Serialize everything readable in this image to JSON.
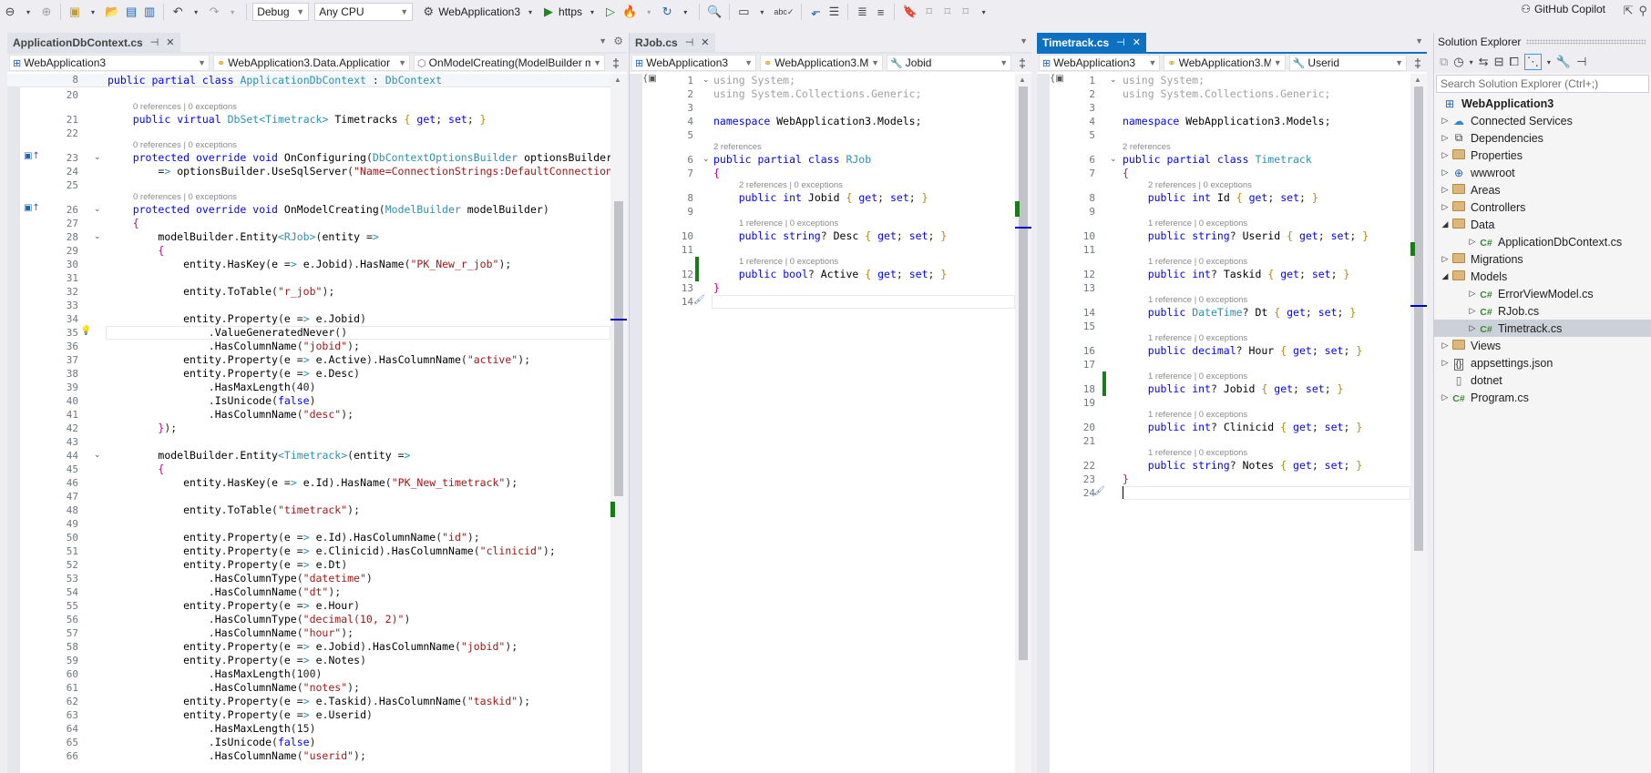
{
  "toolbar": {
    "config": "Debug",
    "platform": "Any CPU",
    "startup_project": "WebApplication3",
    "run_profile": "https",
    "copilot_label": "GitHub Copilot"
  },
  "left_editor": {
    "tab_title": "ApplicationDbContext.cs",
    "project_combo": "WebApplication3",
    "type_combo": "WebApplication3.Data.Applicatior",
    "member_combo": "OnModelCreating(ModelBuilder m",
    "sticky_line": {
      "num": "8",
      "text": "public partial class ApplicationDbContext : DbContext"
    },
    "lines": [
      {
        "num": "20",
        "text": ""
      },
      {
        "lens": "0 references | 0 exceptions"
      },
      {
        "num": "21",
        "text": "    public virtual DbSet<Timetrack> Timetracks { get; set; }"
      },
      {
        "num": "22",
        "text": ""
      },
      {
        "lens": "0 references | 0 exceptions"
      },
      {
        "num": "23",
        "text": "    protected override void OnConfiguring(DbContextOptionsBuilder optionsBuilder)"
      },
      {
        "num": "24",
        "text": "        => optionsBuilder.UseSqlServer(\"Name=ConnectionStrings:DefaultConnection\");"
      },
      {
        "num": "25",
        "text": ""
      },
      {
        "lens": "0 references | 0 exceptions"
      },
      {
        "num": "26",
        "text": "    protected override void OnModelCreating(ModelBuilder modelBuilder)"
      },
      {
        "num": "27",
        "text": "    {"
      },
      {
        "num": "28",
        "text": "        modelBuilder.Entity<RJob>(entity =>"
      },
      {
        "num": "29",
        "text": "        {"
      },
      {
        "num": "30",
        "text": "            entity.HasKey(e => e.Jobid).HasName(\"PK_New_r_job\");"
      },
      {
        "num": "31",
        "text": ""
      },
      {
        "num": "32",
        "text": "            entity.ToTable(\"r_job\");"
      },
      {
        "num": "33",
        "text": ""
      },
      {
        "num": "34",
        "text": "            entity.Property(e => e.Jobid)"
      },
      {
        "num": "35",
        "text": "                .ValueGeneratedNever()"
      },
      {
        "num": "36",
        "text": "                .HasColumnName(\"jobid\");"
      },
      {
        "num": "37",
        "text": "            entity.Property(e => e.Active).HasColumnName(\"active\");"
      },
      {
        "num": "38",
        "text": "            entity.Property(e => e.Desc)"
      },
      {
        "num": "39",
        "text": "                .HasMaxLength(40)"
      },
      {
        "num": "40",
        "text": "                .IsUnicode(false)"
      },
      {
        "num": "41",
        "text": "                .HasColumnName(\"desc\");"
      },
      {
        "num": "42",
        "text": "        });"
      },
      {
        "num": "43",
        "text": ""
      },
      {
        "num": "44",
        "text": "        modelBuilder.Entity<Timetrack>(entity =>"
      },
      {
        "num": "45",
        "text": "        {"
      },
      {
        "num": "46",
        "text": "            entity.HasKey(e => e.Id).HasName(\"PK_New_timetrack\");"
      },
      {
        "num": "47",
        "text": ""
      },
      {
        "num": "48",
        "text": "            entity.ToTable(\"timetrack\");"
      },
      {
        "num": "49",
        "text": ""
      },
      {
        "num": "50",
        "text": "            entity.Property(e => e.Id).HasColumnName(\"id\");"
      },
      {
        "num": "51",
        "text": "            entity.Property(e => e.Clinicid).HasColumnName(\"clinicid\");"
      },
      {
        "num": "52",
        "text": "            entity.Property(e => e.Dt)"
      },
      {
        "num": "53",
        "text": "                .HasColumnType(\"datetime\")"
      },
      {
        "num": "54",
        "text": "                .HasColumnName(\"dt\");"
      },
      {
        "num": "55",
        "text": "            entity.Property(e => e.Hour)"
      },
      {
        "num": "56",
        "text": "                .HasColumnType(\"decimal(10, 2)\")"
      },
      {
        "num": "57",
        "text": "                .HasColumnName(\"hour\");"
      },
      {
        "num": "58",
        "text": "            entity.Property(e => e.Jobid).HasColumnName(\"jobid\");"
      },
      {
        "num": "59",
        "text": "            entity.Property(e => e.Notes)"
      },
      {
        "num": "60",
        "text": "                .HasMaxLength(100)"
      },
      {
        "num": "61",
        "text": "                .HasColumnName(\"notes\");"
      },
      {
        "num": "62",
        "text": "            entity.Property(e => e.Taskid).HasColumnName(\"taskid\");"
      },
      {
        "num": "63",
        "text": "            entity.Property(e => e.Userid)"
      },
      {
        "num": "64",
        "text": "                .HasMaxLength(15)"
      },
      {
        "num": "65",
        "text": "                .IsUnicode(false)"
      },
      {
        "num": "66",
        "text": "                .HasColumnName(\"userid\");"
      }
    ]
  },
  "middle_editor": {
    "tab_title": "RJob.cs",
    "project_combo": "WebApplication3",
    "type_combo": "WebApplication3.M",
    "member_combo": "Jobid",
    "lines": [
      {
        "num": "1",
        "text": "using System;"
      },
      {
        "num": "2",
        "text": "using System.Collections.Generic;"
      },
      {
        "num": "3",
        "text": ""
      },
      {
        "num": "4",
        "text": "namespace WebApplication3.Models;"
      },
      {
        "num": "5",
        "text": ""
      },
      {
        "lens": "2 references"
      },
      {
        "num": "6",
        "text": "public partial class RJob"
      },
      {
        "num": "7",
        "text": "{"
      },
      {
        "lens": "2 references | 0 exceptions"
      },
      {
        "num": "8",
        "text": "    public int Jobid { get; set; }"
      },
      {
        "num": "9",
        "text": ""
      },
      {
        "lens": "1 reference | 0 exceptions"
      },
      {
        "num": "10",
        "text": "    public string? Desc { get; set; }"
      },
      {
        "num": "11",
        "text": ""
      },
      {
        "lens": "1 reference | 0 exceptions"
      },
      {
        "num": "12",
        "text": "    public bool? Active { get; set; }"
      },
      {
        "num": "13",
        "text": "}"
      },
      {
        "num": "14",
        "text": ""
      }
    ]
  },
  "right_editor": {
    "tab_title": "Timetrack.cs",
    "project_combo": "WebApplication3",
    "type_combo": "WebApplication3.M",
    "member_combo": "Userid",
    "lines": [
      {
        "num": "1",
        "text": "using System;"
      },
      {
        "num": "2",
        "text": "using System.Collections.Generic;"
      },
      {
        "num": "3",
        "text": ""
      },
      {
        "num": "4",
        "text": "namespace WebApplication3.Models;"
      },
      {
        "num": "5",
        "text": ""
      },
      {
        "lens": "2 references"
      },
      {
        "num": "6",
        "text": "public partial class Timetrack"
      },
      {
        "num": "7",
        "text": "{"
      },
      {
        "lens": "2 references | 0 exceptions"
      },
      {
        "num": "8",
        "text": "    public int Id { get; set; }"
      },
      {
        "num": "9",
        "text": ""
      },
      {
        "lens": "1 reference | 0 exceptions"
      },
      {
        "num": "10",
        "text": "    public string? Userid { get; set; }"
      },
      {
        "num": "11",
        "text": ""
      },
      {
        "lens": "1 reference | 0 exceptions"
      },
      {
        "num": "12",
        "text": "    public int? Taskid { get; set; }"
      },
      {
        "num": "13",
        "text": ""
      },
      {
        "lens": "1 reference | 0 exceptions"
      },
      {
        "num": "14",
        "text": "    public DateTime? Dt { get; set; }"
      },
      {
        "num": "15",
        "text": ""
      },
      {
        "lens": "1 reference | 0 exceptions"
      },
      {
        "num": "16",
        "text": "    public decimal? Hour { get; set; }"
      },
      {
        "num": "17",
        "text": ""
      },
      {
        "lens": "1 reference | 0 exceptions"
      },
      {
        "num": "18",
        "text": "    public int? Jobid { get; set; }"
      },
      {
        "num": "19",
        "text": ""
      },
      {
        "lens": "1 reference | 0 exceptions"
      },
      {
        "num": "20",
        "text": "    public int? Clinicid { get; set; }"
      },
      {
        "num": "21",
        "text": ""
      },
      {
        "lens": "1 reference | 0 exceptions"
      },
      {
        "num": "22",
        "text": "    public string? Notes { get; set; }"
      },
      {
        "num": "23",
        "text": "}"
      },
      {
        "num": "24",
        "text": ""
      }
    ]
  },
  "solution_explorer": {
    "title": "Solution Explorer",
    "search_placeholder": "Search Solution Explorer (Ctrl+;)",
    "tree": [
      {
        "label": "WebApplication3",
        "icon": "project-icon",
        "level": 0,
        "expander": "",
        "root": true
      },
      {
        "label": "Connected Services",
        "icon": "connected-services-icon",
        "level": 1,
        "expander": "collapsed"
      },
      {
        "label": "Dependencies",
        "icon": "dependencies-icon",
        "level": 1,
        "expander": "collapsed"
      },
      {
        "label": "Properties",
        "icon": "properties-folder-icon",
        "level": 1,
        "expander": "collapsed"
      },
      {
        "label": "wwwroot",
        "icon": "globe-icon",
        "level": 1,
        "expander": "collapsed"
      },
      {
        "label": "Areas",
        "icon": "folder-icon",
        "level": 1,
        "expander": "collapsed"
      },
      {
        "label": "Controllers",
        "icon": "folder-icon",
        "level": 1,
        "expander": "collapsed"
      },
      {
        "label": "Data",
        "icon": "folder-icon",
        "level": 1,
        "expander": "expanded"
      },
      {
        "label": "ApplicationDbContext.cs",
        "icon": "csharp-file-icon",
        "level": 2,
        "expander": "collapsed"
      },
      {
        "label": "Migrations",
        "icon": "folder-icon",
        "level": 1,
        "expander": "collapsed"
      },
      {
        "label": "Models",
        "icon": "folder-icon",
        "level": 1,
        "expander": "expanded"
      },
      {
        "label": "ErrorViewModel.cs",
        "icon": "csharp-file-icon",
        "level": 2,
        "expander": "collapsed"
      },
      {
        "label": "RJob.cs",
        "icon": "csharp-file-icon",
        "level": 2,
        "expander": "collapsed"
      },
      {
        "label": "Timetrack.cs",
        "icon": "csharp-file-icon",
        "level": 2,
        "expander": "collapsed",
        "selected": true
      },
      {
        "label": "Views",
        "icon": "folder-icon",
        "level": 1,
        "expander": "collapsed"
      },
      {
        "label": "appsettings.json",
        "icon": "json-file-icon",
        "level": 1,
        "expander": "collapsed"
      },
      {
        "label": "dotnet",
        "icon": "file-icon",
        "level": 1,
        "expander": ""
      },
      {
        "label": "Program.cs",
        "icon": "csharp-file-icon",
        "level": 1,
        "expander": "collapsed"
      }
    ]
  }
}
